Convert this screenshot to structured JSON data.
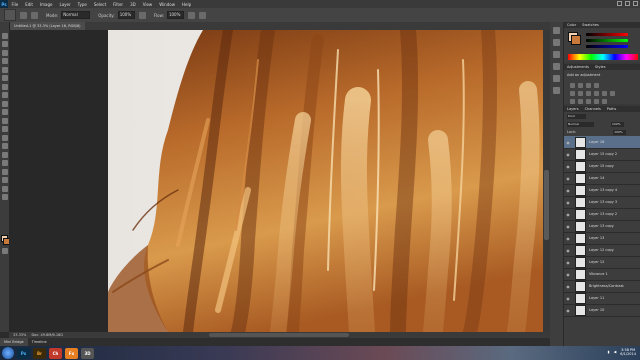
{
  "menubar": {
    "app_logo": "Ps",
    "items": [
      "File",
      "Edit",
      "Image",
      "Layer",
      "Type",
      "Select",
      "Filter",
      "3D",
      "View",
      "Window",
      "Help"
    ]
  },
  "options": {
    "mode_label": "Mode:",
    "mode_value": "Normal",
    "opacity_label": "Opacity:",
    "opacity_value": "100%",
    "flow_label": "Flow:",
    "flow_value": "100%"
  },
  "document": {
    "tab_title": "Untitled-1 @ 33.3% (Layer 16, RGB/8)",
    "zoom": "33.33%",
    "doc_info": "Doc: 49.8M/6.18G"
  },
  "panels": {
    "color_tabs": [
      "Color",
      "Swatches"
    ],
    "adjustments_tabs": [
      "Adjustments",
      "Styles"
    ],
    "adjustments_title": "Add an adjustment",
    "layers_tabs": [
      "Layers",
      "Channels",
      "Paths"
    ],
    "kind_label": "Kind",
    "blend_mode": "Normal",
    "opacity_value": "100%",
    "lock_label": "Lock:",
    "fill_value": "100%"
  },
  "layers": [
    {
      "name": "Layer 16",
      "selected": true
    },
    {
      "name": "Layer 15 copy 2",
      "selected": false
    },
    {
      "name": "Layer 15 copy",
      "selected": false
    },
    {
      "name": "Layer 14",
      "selected": false
    },
    {
      "name": "Layer 13 copy 4",
      "selected": false
    },
    {
      "name": "Layer 13 copy 3",
      "selected": false
    },
    {
      "name": "Layer 13 copy 2",
      "selected": false
    },
    {
      "name": "Layer 13 copy",
      "selected": false
    },
    {
      "name": "Layer 13",
      "selected": false
    },
    {
      "name": "Layer 12 copy",
      "selected": false
    },
    {
      "name": "Layer 12",
      "selected": false
    },
    {
      "name": "Vibrance 1",
      "selected": false
    },
    {
      "name": "Brightness/Contrast",
      "selected": false
    },
    {
      "name": "Layer 11",
      "selected": false
    },
    {
      "name": "Layer 10",
      "selected": false
    }
  ],
  "mini_bridge": {
    "tabs": [
      "Mini Bridge",
      "Timeline"
    ]
  },
  "taskbar": {
    "apps": [
      "Ps",
      "Br",
      "Ch",
      "Fx",
      "3D"
    ],
    "time": "3:58 PM",
    "date": "6/1/2014"
  },
  "colors": {
    "foreground": "#f2d2b3",
    "background": "#c77a3c",
    "selection": "#5a6f8a"
  }
}
